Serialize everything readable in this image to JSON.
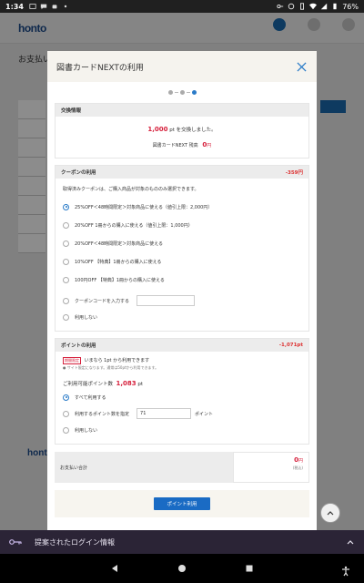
{
  "status_bar": {
    "time": "1:34",
    "battery": "76%"
  },
  "background": {
    "logo": "honto",
    "title": "お支払い",
    "footer_logo": "honto"
  },
  "modal": {
    "title": "図書カードNEXTの利用",
    "exchange": {
      "header": "交換情報",
      "amount": "1,000",
      "amount_suffix": "pt を交換しました。",
      "balance_label": "図書カードNEXT 残高",
      "balance_value": "0",
      "balance_unit": "円"
    },
    "coupon": {
      "header": "クーポンの利用",
      "amount": "-359円",
      "description": "取得済みクーポンは、ご購入商品が対象のもののみ選択できます。",
      "options": [
        {
          "label": "25%OFF＜48時間限定＞対象商品に使える（値引上限：2,000円）",
          "checked": true
        },
        {
          "label": "20%OFF 1冊からの購入に使える（値引上限：1,000円）",
          "checked": false
        },
        {
          "label": "20%OFF＜48時間限定＞対象商品に使える",
          "checked": false
        },
        {
          "label": "10%OFF 【特典】1冊からの購入に使える",
          "checked": false
        },
        {
          "label": "100円OFF 【特典】1冊からの購入に使える",
          "checked": false
        }
      ],
      "code_label": "クーポンコードを入力する",
      "code_value": "",
      "none_label": "利用しない"
    },
    "points": {
      "header": "ポイントの利用",
      "amount": "-1,071pt",
      "badge": "期間限定",
      "top_text": "いまなら 1pt から利用できます",
      "note": "● サイト限定になります。通常は50ptから利用できます。",
      "available_label": "ご利用可能ポイント数",
      "available_value": "1,083",
      "available_unit": "pt",
      "option_all": "すべて利用する",
      "option_specify": "利用するポイント数を指定",
      "specify_value": "71",
      "specify_unit": "ポイント",
      "option_none": "利用しない"
    },
    "total": {
      "label": "お支払い合計",
      "value": "0",
      "unit": "円",
      "tax": "(税込)"
    },
    "action_button": "ポイント利用"
  },
  "login_banner": {
    "text": "提案されたログイン情報"
  },
  "colors": {
    "accent": "#1a6bc4",
    "price_red": "#d6203c"
  }
}
